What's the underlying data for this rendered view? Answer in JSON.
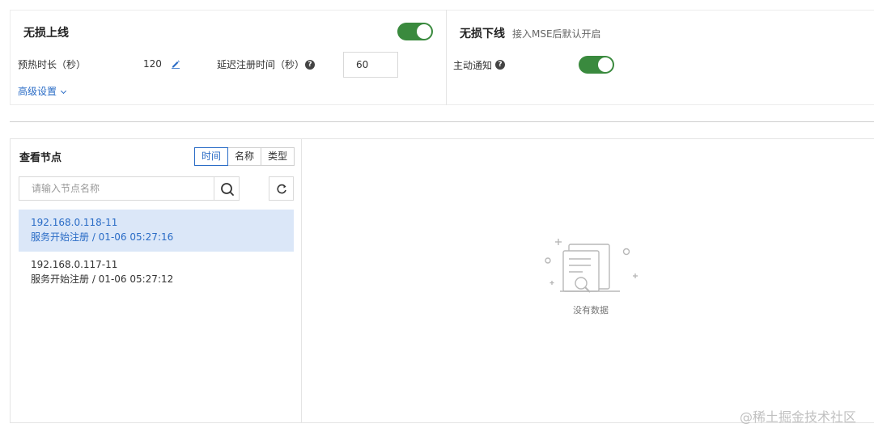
{
  "online": {
    "title": "无损上线",
    "warmup_label": "预热时长（秒）",
    "warmup_value": "120",
    "delay_label": "延迟注册时间（秒）",
    "delay_value": "60",
    "advanced_label": "高级设置",
    "enabled": true
  },
  "offline": {
    "title": "无损下线",
    "hint": "接入MSE后默认开启",
    "notify_label": "主动通知",
    "notify_enabled": true
  },
  "nodes": {
    "title": "查看节点",
    "sort_tabs": [
      "时间",
      "名称",
      "类型"
    ],
    "active_sort": "时间",
    "search_placeholder": "请输入节点名称",
    "items": [
      {
        "ip": "192.168.0.118-11",
        "event": "服务开始注册 / 01-06 05:27:16",
        "selected": true
      },
      {
        "ip": "192.168.0.117-11",
        "event": "服务开始注册 / 01-06 05:27:12",
        "selected": false
      }
    ]
  },
  "detail": {
    "empty_text": "没有数据"
  },
  "watermark": "@稀土掘金技术社区",
  "colors": {
    "accent": "#2a6cc6",
    "toggle_on": "#3a8a3e",
    "selected_bg": "#dbe7f8"
  }
}
